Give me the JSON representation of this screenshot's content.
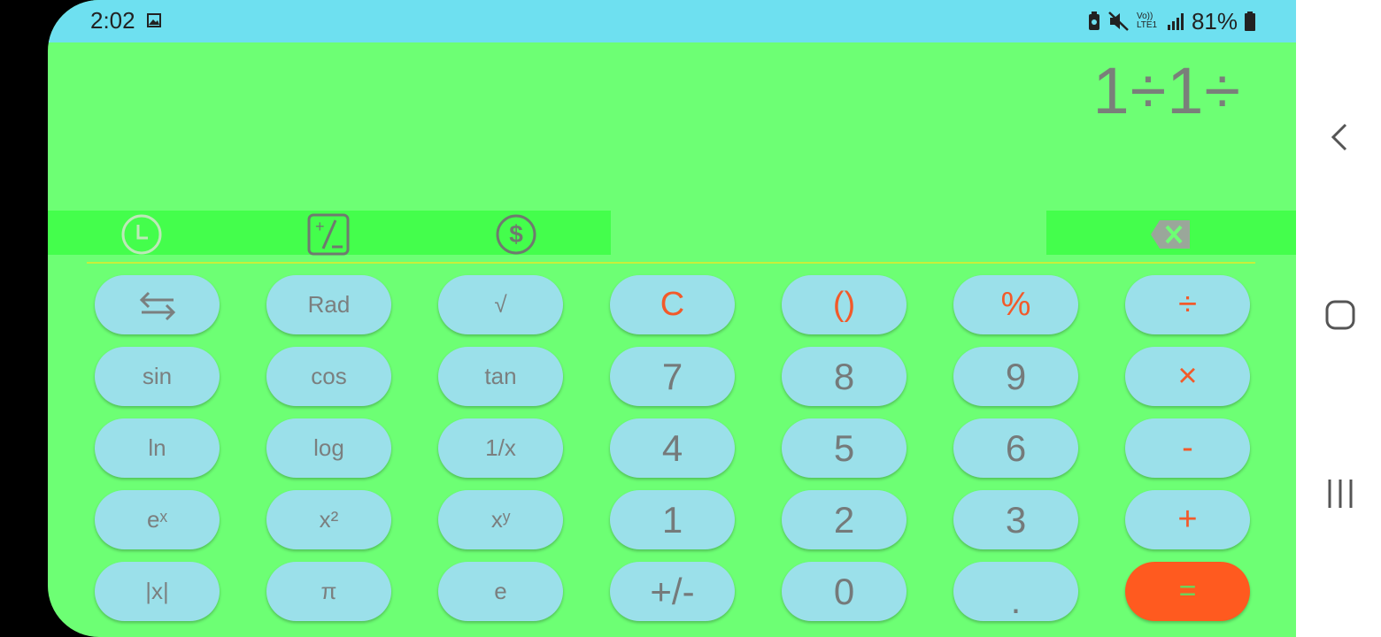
{
  "status_bar": {
    "time": "2:02",
    "network": "Vo)) LTE1",
    "battery": "81%",
    "icons": [
      "gallery-icon",
      "battery-saver-icon",
      "mute-icon",
      "signal-icon",
      "battery-icon"
    ]
  },
  "display": {
    "expression": "1÷1÷"
  },
  "toolbar": {
    "icons": [
      "history-icon",
      "unit-convert-icon",
      "currency-icon",
      "backspace-icon"
    ]
  },
  "keys": [
    {
      "name": "swap-button",
      "label": "",
      "icon": "swap-icon",
      "style": "fn"
    },
    {
      "name": "rad-button",
      "label": "Rad",
      "style": "fn"
    },
    {
      "name": "sqrt-button",
      "label": "√",
      "style": "fn"
    },
    {
      "name": "clear-button",
      "label": "C",
      "style": "op"
    },
    {
      "name": "parentheses-button",
      "label": "()",
      "style": "op"
    },
    {
      "name": "percent-button",
      "label": "%",
      "style": "op"
    },
    {
      "name": "divide-button",
      "label": "÷",
      "style": "op"
    },
    {
      "name": "sin-button",
      "label": "sin",
      "style": "fn"
    },
    {
      "name": "cos-button",
      "label": "cos",
      "style": "fn"
    },
    {
      "name": "tan-button",
      "label": "tan",
      "style": "fn"
    },
    {
      "name": "digit-7-button",
      "label": "7",
      "style": "digit"
    },
    {
      "name": "digit-8-button",
      "label": "8",
      "style": "digit"
    },
    {
      "name": "digit-9-button",
      "label": "9",
      "style": "digit"
    },
    {
      "name": "multiply-button",
      "label": "×",
      "style": "op"
    },
    {
      "name": "ln-button",
      "label": "ln",
      "style": "fn"
    },
    {
      "name": "log-button",
      "label": "log",
      "style": "fn"
    },
    {
      "name": "reciprocal-button",
      "label": "1/x",
      "style": "fn"
    },
    {
      "name": "digit-4-button",
      "label": "4",
      "style": "digit"
    },
    {
      "name": "digit-5-button",
      "label": "5",
      "style": "digit"
    },
    {
      "name": "digit-6-button",
      "label": "6",
      "style": "digit"
    },
    {
      "name": "minus-button",
      "label": "-",
      "style": "op"
    },
    {
      "name": "exp-button",
      "label": "eˣ",
      "style": "fn"
    },
    {
      "name": "square-button",
      "label": "x²",
      "style": "fn"
    },
    {
      "name": "power-button",
      "label": "xʸ",
      "style": "fn"
    },
    {
      "name": "digit-1-button",
      "label": "1",
      "style": "digit"
    },
    {
      "name": "digit-2-button",
      "label": "2",
      "style": "digit"
    },
    {
      "name": "digit-3-button",
      "label": "3",
      "style": "digit"
    },
    {
      "name": "plus-button",
      "label": "+",
      "style": "op"
    },
    {
      "name": "abs-button",
      "label": "|x|",
      "style": "fn"
    },
    {
      "name": "pi-button",
      "label": "π",
      "style": "fn"
    },
    {
      "name": "e-button",
      "label": "e",
      "style": "fn"
    },
    {
      "name": "sign-toggle-button",
      "label": "+/-",
      "style": "digit"
    },
    {
      "name": "digit-0-button",
      "label": "0",
      "style": "digit"
    },
    {
      "name": "decimal-button",
      "label": ".",
      "style": "digit"
    },
    {
      "name": "equals-button",
      "label": "=",
      "style": "equals"
    }
  ],
  "colors": {
    "background": "#6dff74",
    "status_bar": "#6ee0f0",
    "key": "#9be0ea",
    "operator_text": "#f25a2a",
    "equals_key": "#ff5a1f"
  },
  "nav_bar": {
    "icons": [
      "back-icon",
      "home-icon",
      "recents-icon"
    ]
  }
}
